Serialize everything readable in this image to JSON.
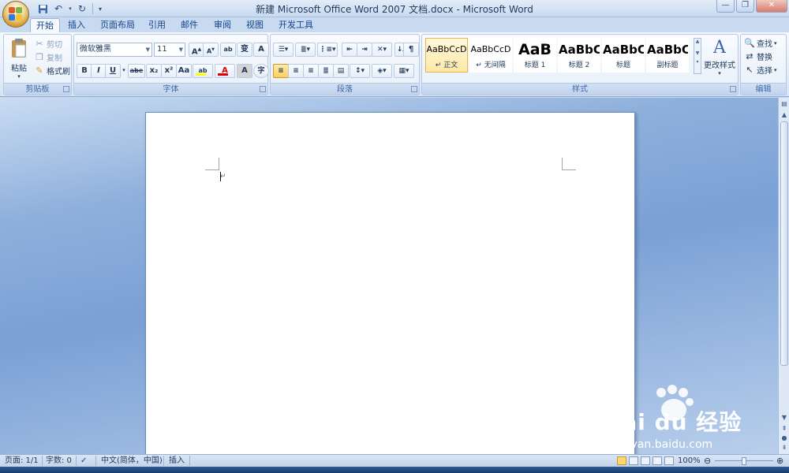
{
  "window": {
    "title": "新建 Microsoft Office Word 2007 文档.docx - Microsoft Word"
  },
  "quick_access": [
    "save-icon",
    "undo-icon",
    "redo-icon"
  ],
  "tabs": [
    "开始",
    "插入",
    "页面布局",
    "引用",
    "邮件",
    "审阅",
    "视图",
    "开发工具"
  ],
  "clipboard": {
    "paste": "粘贴",
    "cut": "剪切",
    "copy": "复制",
    "format_painter": "格式刷",
    "label": "剪贴板"
  },
  "font": {
    "family": "微软雅黑",
    "size": "11",
    "label": "字体",
    "buttons": [
      "B",
      "I",
      "U",
      "abe",
      "x₂",
      "x²",
      "Aa"
    ]
  },
  "paragraph": {
    "label": "段落"
  },
  "styles": {
    "label": "样式",
    "items": [
      {
        "sample": "AaBbCcD",
        "name": "↵ 正文"
      },
      {
        "sample": "AaBbCcD",
        "name": "↵ 无间隔"
      },
      {
        "sample": "AaB",
        "name": "标题 1"
      },
      {
        "sample": "AaBbC",
        "name": "标题 2"
      },
      {
        "sample": "AaBbC",
        "name": "标题"
      },
      {
        "sample": "AaBbC",
        "name": "副标题"
      }
    ],
    "change": "更改样式"
  },
  "editing": {
    "label": "编辑",
    "find": "查找",
    "replace": "替换",
    "select": "选择"
  },
  "status": {
    "page": "页面: 1/1",
    "words": "字数: 0",
    "language": "中文(简体，中国)",
    "mode": "插入",
    "zoom": "100%"
  },
  "watermark": {
    "brand": "Bai du 经验",
    "url": "jingyan.baidu.com"
  },
  "colors": {
    "ribbon_text": "#15428b",
    "highlight": "#ffff00",
    "font_color": "#e00000",
    "selected_style": "#ffe8a6"
  }
}
